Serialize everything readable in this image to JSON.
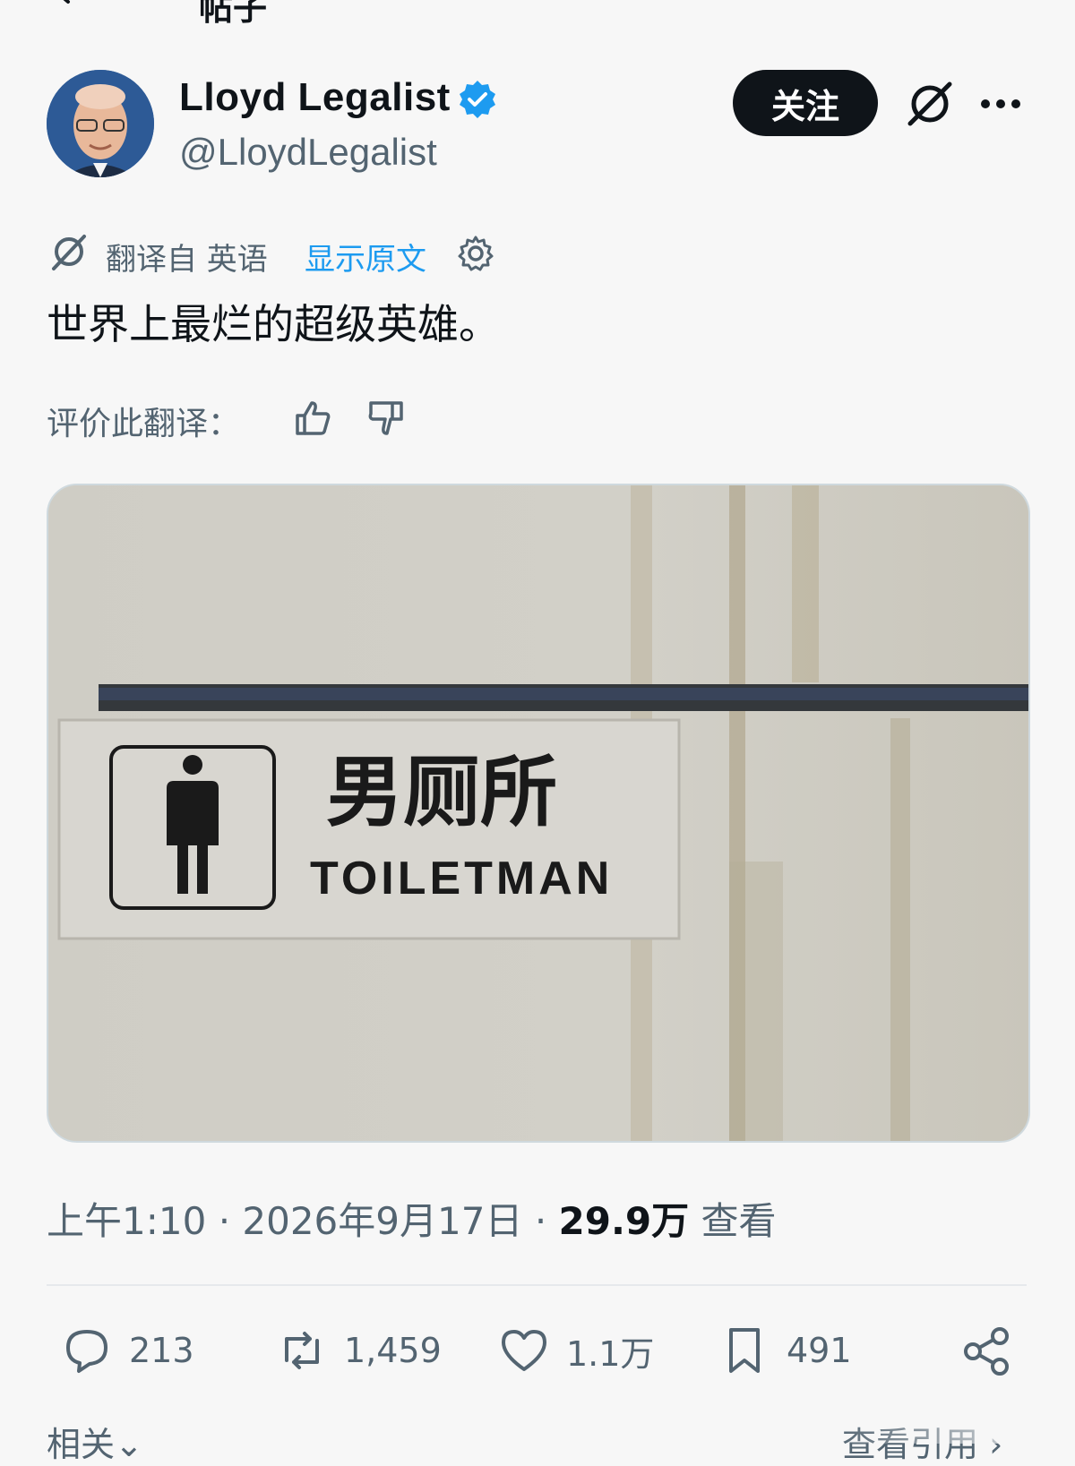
{
  "header": {
    "title": "帖子",
    "back_icon": "arrow-left-icon"
  },
  "author": {
    "display_name": "Lloyd Legalist",
    "handle": "@LloydLegalist",
    "verified": true,
    "verified_color": "#1d9bf0"
  },
  "actions_top": {
    "follow_label": "关注",
    "grok_icon": "grok-icon",
    "more_icon": "more-icon"
  },
  "translation": {
    "label": "翻译自 英语",
    "show_original": "显示原文",
    "rate_label": "评价此翻译："
  },
  "post": {
    "text": "世界上最烂的超级英雄。",
    "sign_chinese": "男厕所",
    "sign_english": "TOILETMAN"
  },
  "meta": {
    "time": "上午1:10",
    "date": "2026年9月17日",
    "views_count": "29.9万",
    "views_label": "查看"
  },
  "stats": {
    "replies": "213",
    "reposts": "1,459",
    "likes": "1.1万",
    "bookmarks": "491"
  },
  "footer": {
    "related_label": "相关",
    "quotes_label": "查看引用"
  },
  "colors": {
    "accent": "#1d9bf0",
    "text": "#0f1419",
    "secondary": "#536471"
  }
}
